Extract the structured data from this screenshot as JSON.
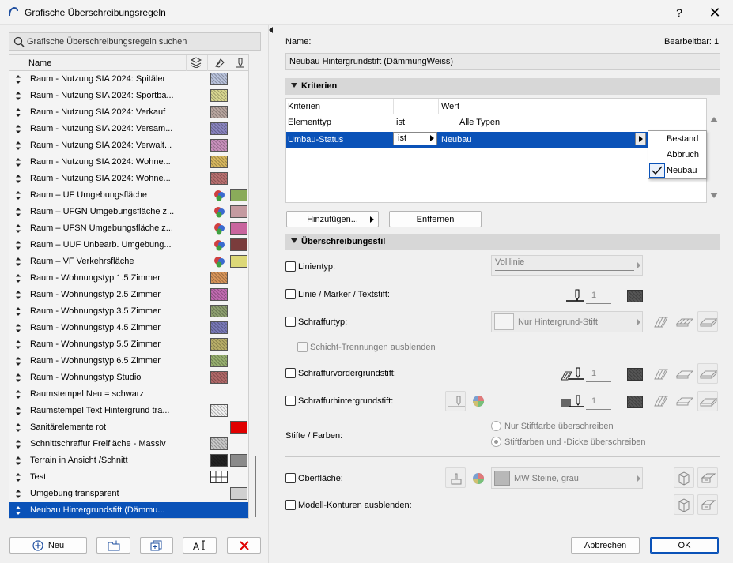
{
  "window": {
    "title": "Grafische Überschreibungsregeln",
    "help_label": "?",
    "close_label": "✕"
  },
  "search": {
    "placeholder": "Grafische Überschreibungsregeln suchen"
  },
  "list": {
    "column_name": "Name",
    "rows": [
      {
        "label": "Raum - Nutzung SIA 2024: Spitäler",
        "swatch": "#b9c3dc"
      },
      {
        "label": "Raum - Nutzung SIA 2024: Sportba...",
        "swatch": "#d8d690"
      },
      {
        "label": "Raum - Nutzung SIA 2024: Verkauf",
        "swatch": "#b8a6a0"
      },
      {
        "label": "Raum - Nutzung SIA 2024: Versam...",
        "swatch": "#8a85c0"
      },
      {
        "label": "Raum - Nutzung SIA 2024: Verwalt...",
        "swatch": "#c890bc"
      },
      {
        "label": "Raum - Nutzung SIA 2024: Wohne...",
        "swatch": "#d8b860"
      },
      {
        "label": "Raum - Nutzung SIA 2024: Wohne...",
        "swatch": "#b87070"
      },
      {
        "label": "Raum – UF Umgebungsfläche",
        "swatch": "#8aab5a",
        "fill_icon": true
      },
      {
        "label": "Raum – UFGN Umgebungsfläche z...",
        "swatch": "#c49aa0",
        "fill_icon": true
      },
      {
        "label": "Raum – UFSN Umgebungsfläche z...",
        "swatch": "#c8659e",
        "fill_icon": true
      },
      {
        "label": "Raum – UUF Unbearb. Umgebung...",
        "swatch": "#7a3c3c",
        "fill_icon": true
      },
      {
        "label": "Raum – VF Verkehrsfläche",
        "swatch": "#dcd878",
        "fill_icon": true
      },
      {
        "label": "Raum - Wohnungstyp 1.5 Zimmer",
        "swatch": "#d8955a"
      },
      {
        "label": "Raum - Wohnungstyp 2.5 Zimmer",
        "swatch": "#c06ab0"
      },
      {
        "label": "Raum - Wohnungstyp 3.5 Zimmer",
        "swatch": "#8ea070"
      },
      {
        "label": "Raum - Wohnungstyp 4.5 Zimmer",
        "swatch": "#7a7ab8"
      },
      {
        "label": "Raum - Wohnungstyp 5.5 Zimmer",
        "swatch": "#b8ae68"
      },
      {
        "label": "Raum - Wohnungstyp 6.5 Zimmer",
        "swatch": "#98b070"
      },
      {
        "label": "Raum - Wohnungstyp Studio",
        "swatch": "#b06868"
      },
      {
        "label": "Raumstempel Neu = schwarz"
      },
      {
        "label": "Raumstempel Text Hintergrund tra...",
        "swatch": "#f0f0f0"
      },
      {
        "label": "Sanitärelemente rot",
        "swatch2": "#e00000"
      },
      {
        "label": "Schnittschraffur Freifläche - Massiv",
        "swatch": "#c8c8c8"
      },
      {
        "label": "Terrain in Ansicht /Schnitt",
        "swatch": "#222222",
        "swatch2": "#8a8a8a"
      },
      {
        "label": "Test",
        "grid_icon": true
      },
      {
        "label": "Umgebung transparent",
        "swatch2": "#d0d0d0"
      },
      {
        "label": "Neubau Hintergrundstift (Dämmu...",
        "selected": true
      }
    ]
  },
  "bottom_left": {
    "new_label": "Neu"
  },
  "form": {
    "name_label": "Name:",
    "editable_label": "Bearbeitbar: 1",
    "name_value": "Neubau Hintergrundstift (DämmungWeiss)",
    "criteria_section": "Kriterien",
    "criteria_table": {
      "header": [
        "Kriterien",
        "",
        "Wert"
      ],
      "rows": [
        [
          "Elementtyp",
          "ist",
          "Alle Typen"
        ],
        [
          "Umbau-Status",
          "ist",
          "Neubau"
        ]
      ]
    },
    "dropdown_options": [
      "Bestand",
      "Abbruch",
      "Neubau"
    ],
    "add_label": "Hinzufügen...",
    "remove_label": "Entfernen",
    "style_section": "Überschreibungsstil",
    "line_type_label": "Linientyp:",
    "line_type_value": "Volllinie",
    "line_marker_label": "Linie / Marker / Textstift:",
    "line_pen_num": "1",
    "hatch_type_label": "Schraffurtyp:",
    "hatch_type_value": "Nur Hintergrund-Stift",
    "hide_layer_label": "Schicht-Trennungen ausblenden",
    "hatch_fg_label": "Schraffurvordergrundstift:",
    "hatch_fg_num": "1",
    "hatch_bg_label": "Schraffurhintergrundstift:",
    "hatch_bg_num": "1",
    "pens_colors_label": "Stifte / Farben:",
    "radio_pen_color_only": "Nur Stiftfarbe überschreiben",
    "radio_pen_color_thickness": "Stiftfarben und -Dicke überschreiben",
    "surface_label": "Oberfläche:",
    "surface_value": "MW Steine, grau",
    "hide_contours_label": "Modell-Konturen ausblenden:",
    "cancel_label": "Abbrechen",
    "ok_label": "OK"
  }
}
